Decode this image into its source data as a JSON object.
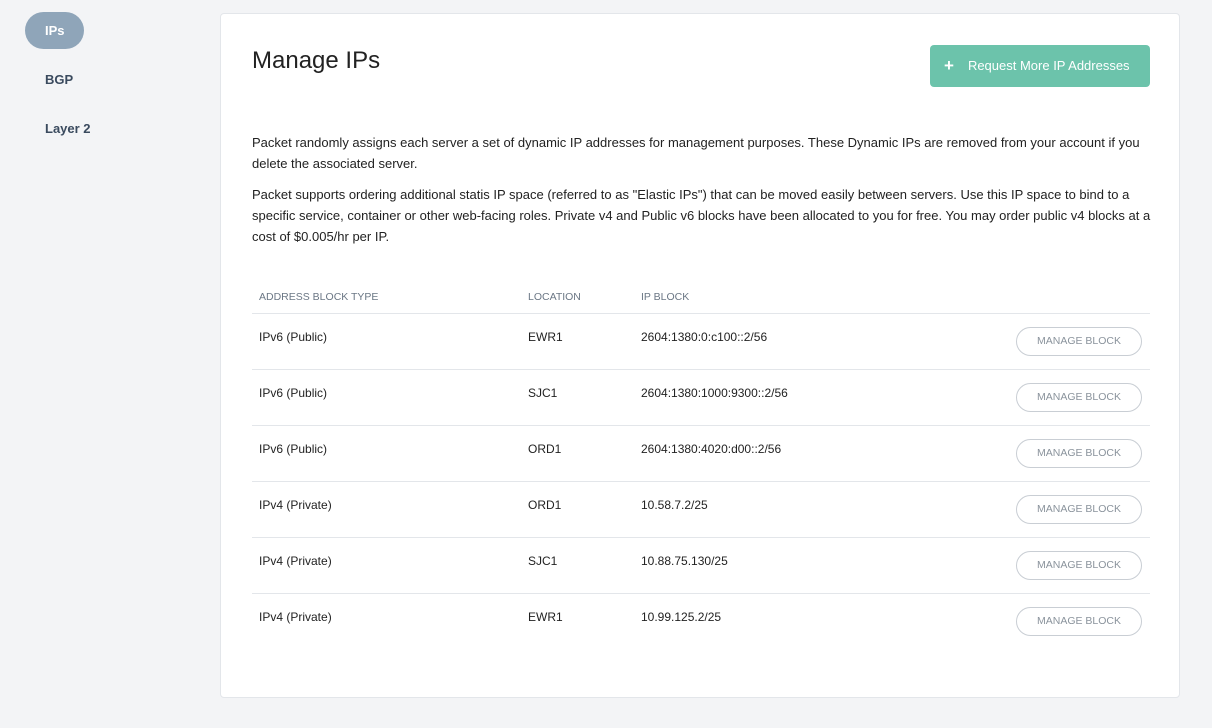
{
  "sidebar": {
    "items": [
      {
        "label": "IPs",
        "active": true
      },
      {
        "label": "BGP"
      },
      {
        "label": "Layer 2"
      }
    ]
  },
  "main": {
    "title": "Manage IPs",
    "request_button": "Request More IP Addresses",
    "paragraphs": [
      "Packet randomly assigns each server a set of dynamic IP addresses for management purposes. These Dynamic IPs are removed from your account if you delete the associated server.",
      "Packet supports ordering additional statis IP space (referred to as \"Elastic IPs\") that can be moved easily between servers. Use this IP space to bind to a specific service, container or other web-facing roles. Private v4 and Public v6 blocks have been allocated to you for free. You may order public v4 blocks at a cost of $0.005/hr per IP."
    ],
    "table": {
      "headers": [
        "ADDRESS BLOCK TYPE",
        "LOCATION",
        "IP BLOCK"
      ],
      "action_label": "MANAGE BLOCK",
      "rows": [
        {
          "type": "IPv6 (Public)",
          "location": "EWR1",
          "block": "2604:1380:0:c100::2/56"
        },
        {
          "type": "IPv6 (Public)",
          "location": "SJC1",
          "block": "2604:1380:1000:9300::2/56"
        },
        {
          "type": "IPv6 (Public)",
          "location": "ORD1",
          "block": "2604:1380:4020:d00::2/56"
        },
        {
          "type": "IPv4 (Private)",
          "location": "ORD1",
          "block": "10.58.7.2/25"
        },
        {
          "type": "IPv4 (Private)",
          "location": "SJC1",
          "block": "10.88.75.130/25"
        },
        {
          "type": "IPv4 (Private)",
          "location": "EWR1",
          "block": "10.99.125.2/25"
        }
      ]
    }
  },
  "colors": {
    "accent": "#6cc3ab",
    "active_nav": "#8fa5b9"
  }
}
